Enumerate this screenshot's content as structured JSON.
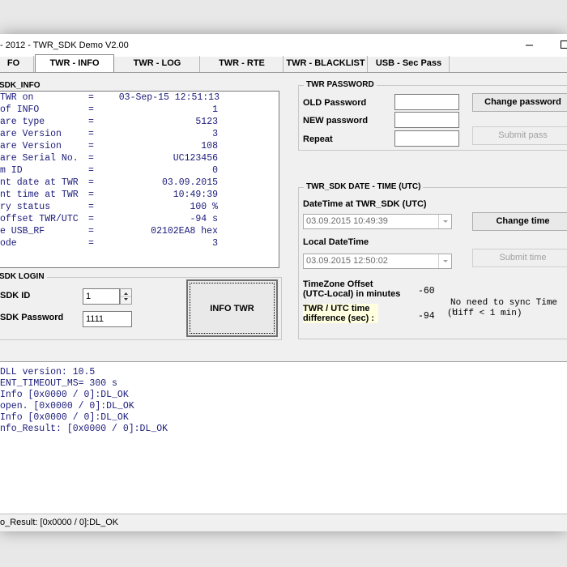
{
  "window": {
    "title": "- 2012  -  TWR_SDK Demo V2.00"
  },
  "tabs": [
    {
      "label": "FO"
    },
    {
      "label": "TWR - INFO"
    },
    {
      "label": "TWR - LOG"
    },
    {
      "label": "TWR - RTE"
    },
    {
      "label": "TWR - BLACKLIST"
    },
    {
      "label": "USB - Sec Pass"
    }
  ],
  "sdk_info": {
    "title": "SDK_INFO",
    "rows": [
      {
        "label": "TWR on",
        "value": "03-Sep-15 12:51:13"
      },
      {
        "label": "of INFO",
        "value": "1"
      },
      {
        "label": "are type",
        "value": "5123"
      },
      {
        "label": "are Version",
        "value": "3"
      },
      {
        "label": "are Version",
        "value": "108"
      },
      {
        "label": "are Serial No.",
        "value": "UC123456"
      },
      {
        "label": "m ID",
        "value": "0"
      },
      {
        "label": "nt date at TWR",
        "value": "03.09.2015"
      },
      {
        "label": "nt time at TWR",
        "value": "10:49:39"
      },
      {
        "label": "ry status",
        "value": "100 %"
      },
      {
        "label": "offset TWR/UTC",
        "value": "-94 s"
      },
      {
        "label": "e USB_RF",
        "value": "02102EA8 hex"
      },
      {
        "label": "ode",
        "value": "3"
      }
    ]
  },
  "sdk_login": {
    "title": "SDK LOGIN",
    "id_label": "SDK ID",
    "id_value": "1",
    "password_label": "SDK Password",
    "password_value": "1111",
    "info_button": "INFO TWR"
  },
  "twr_password": {
    "title": "TWR PASSWORD",
    "old_label": "OLD Password",
    "new_label": "NEW password",
    "repeat_label": "Repeat",
    "old_value": "",
    "new_value": "",
    "repeat_value": "",
    "change_button": "Change password",
    "submit_button": "Submit pass"
  },
  "twr_datetime": {
    "title": "TWR_SDK DATE - TIME  (UTC)",
    "dt_label": "DateTime at TWR_SDK (UTC)",
    "dt_value": "03.09.2015 10:49:39",
    "change_time_button": "Change time",
    "local_label": "Local DateTime",
    "local_value": "03.09.2015 12:50:02",
    "submit_time_button": "Submit time",
    "tz_label_line1": "TimeZone Offset",
    "tz_label_line2": "(UTC-Local) in minutes",
    "tz_value": "-60",
    "diff_label_line1": "TWR / UTC time",
    "diff_label_line2": "difference (sec) :",
    "diff_value": "-94",
    "sync_note_line1": "No need to sync Time !",
    "sync_note_line2": "(diff < 1 min)",
    "diff_highlight_color": "#ffffe0"
  },
  "log": {
    "lines": [
      " DLL version: 10.5",
      "ENT_TIMEOUT_MS= 300 s",
      "Info [0x0000 / 0]:DL_OK",
      "open. [0x0000 / 0]:DL_OK",
      "Info [0x0000 / 0]:DL_OK",
      "nfo_Result: [0x0000 / 0]:DL_OK"
    ]
  },
  "status_bar": {
    "text": "o_Result: [0x0000 / 0]:DL_OK"
  }
}
